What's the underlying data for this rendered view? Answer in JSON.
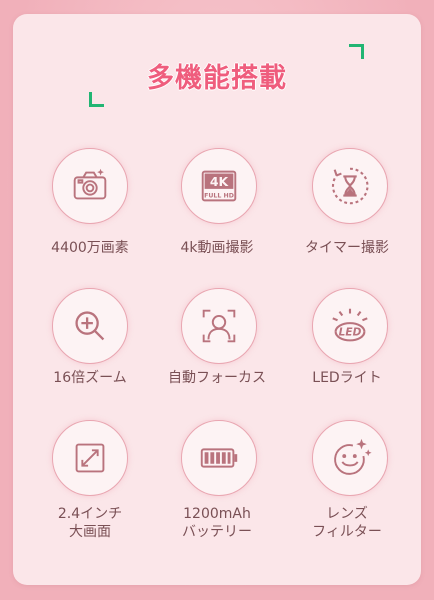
{
  "title": "多機能搭載",
  "features": [
    {
      "label": "4400万画素",
      "icon": "camera-icon"
    },
    {
      "label": "4k動画撮影",
      "icon": "4k-fullhd-icon",
      "badge_top": "4K",
      "badge_bottom": "FULL HD"
    },
    {
      "label": "タイマー撮影",
      "icon": "timer-hourglass-icon"
    },
    {
      "label": "16倍ズーム",
      "icon": "zoom-in-icon"
    },
    {
      "label": "自動フォーカス",
      "icon": "face-focus-icon"
    },
    {
      "label": "LEDライト",
      "icon": "led-light-icon",
      "badge": "LED"
    },
    {
      "label_line1": "2.4インチ",
      "label_line2": "大画面",
      "icon": "expand-screen-icon"
    },
    {
      "label_line1": "1200mAh",
      "label_line2": "バッテリー",
      "icon": "battery-icon"
    },
    {
      "label_line1": "レンズ",
      "label_line2": "フィルター",
      "icon": "smiley-sparkle-icon"
    }
  ],
  "colors": {
    "accent": "#ef5d7d",
    "icon": "#b9737d",
    "bracket": "#22b573",
    "background": "#f1b0ba",
    "card": "#fbe6e9"
  }
}
